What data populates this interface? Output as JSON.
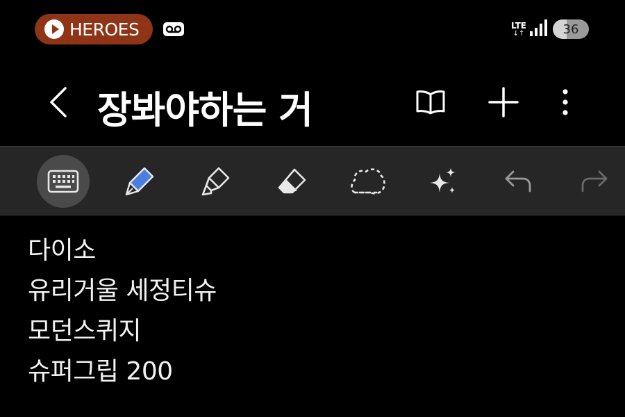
{
  "status_bar": {
    "app_pill_label": "HEROES",
    "network_type": "LTE",
    "network_arrows": "↓↑",
    "battery_level": "36",
    "pill_color": "#8f3417"
  },
  "header": {
    "title": "장봐야하는 거",
    "icons": [
      "back-arrow-icon",
      "book-icon",
      "plus-icon",
      "more-vertical-icon"
    ]
  },
  "toolbar": {
    "tools": [
      "keyboard-icon",
      "pen-icon",
      "highlighter-icon",
      "eraser-icon",
      "lasso-select-icon",
      "ai-sparkle-icon",
      "undo-icon",
      "redo-icon"
    ],
    "active_tool": "keyboard",
    "pen_accent_color": "#4a7fe0"
  },
  "note": {
    "lines": [
      "다이소",
      "유리거울 세정티슈",
      "모던스퀴지",
      "슈퍼그립 200"
    ]
  }
}
